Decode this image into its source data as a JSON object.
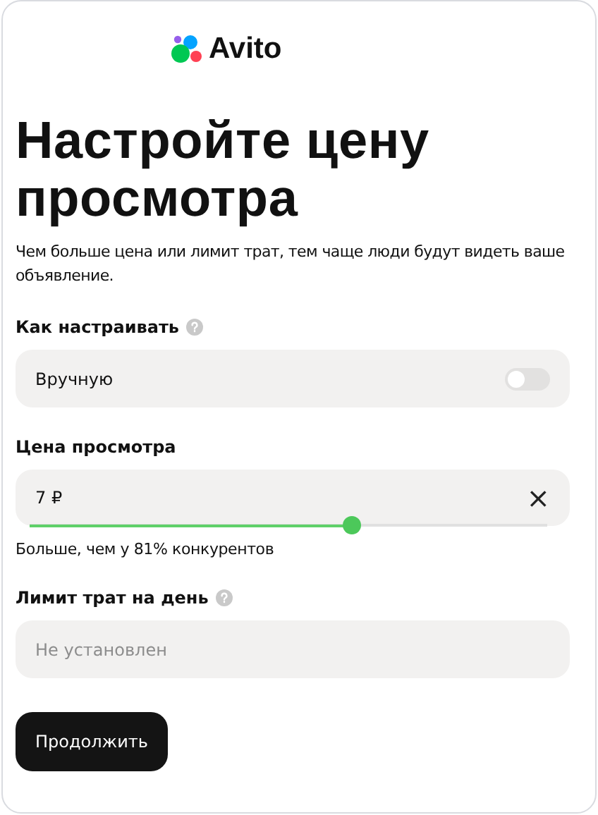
{
  "logo": {
    "text": "Avito"
  },
  "title": "Настройте цену просмотра",
  "description": "Чем больше цена или лимит трат, тем чаще люди будут видеть ваше объявление.",
  "mode": {
    "label": "Как настраивать",
    "option": "Вручную",
    "on": false
  },
  "price": {
    "label": "Цена просмотра",
    "value": "7 ₽",
    "clear": "×",
    "level": 0.62,
    "hint": "Больше, чем у 81% конкурентов"
  },
  "limit": {
    "label": "Лимит трат на день",
    "placeholder": "Не установлен"
  },
  "button": "Продолжить"
}
